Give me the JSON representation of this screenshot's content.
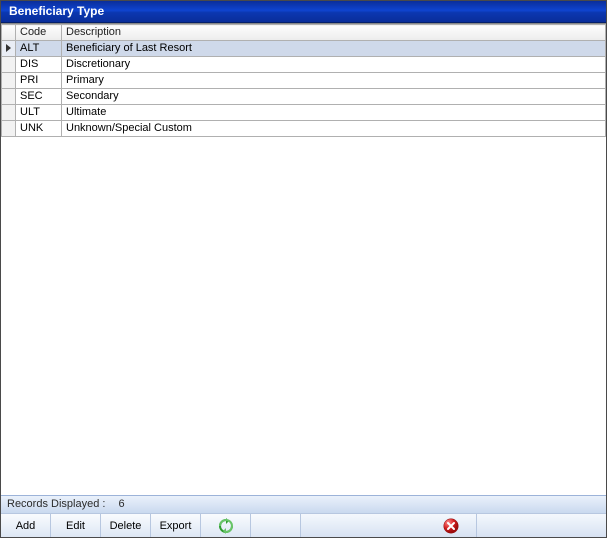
{
  "title": "Beneficiary Type",
  "columns": {
    "code": "Code",
    "description": "Description"
  },
  "rows": [
    {
      "code": "ALT",
      "description": "Beneficiary of Last Resort",
      "selected": true
    },
    {
      "code": "DIS",
      "description": "Discretionary",
      "selected": false
    },
    {
      "code": "PRI",
      "description": "Primary",
      "selected": false
    },
    {
      "code": "SEC",
      "description": "Secondary",
      "selected": false
    },
    {
      "code": "ULT",
      "description": "Ultimate",
      "selected": false
    },
    {
      "code": "UNK",
      "description": "Unknown/Special Custom",
      "selected": false
    }
  ],
  "status": {
    "label": "Records Displayed :",
    "count": "6"
  },
  "toolbar": {
    "add": "Add",
    "edit": "Edit",
    "delete": "Delete",
    "export": "Export"
  }
}
